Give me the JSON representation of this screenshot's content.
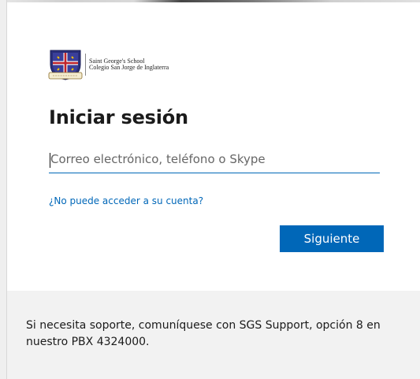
{
  "brand": {
    "crest_icon": "school-crest-icon",
    "name_line1": "Saint George's School",
    "name_line2": "Colegio San Jorge de Inglaterra"
  },
  "signin": {
    "title": "Iniciar sesión",
    "email_placeholder": "Correo electrónico, teléfono o Skype",
    "email_value": "",
    "help_link": "¿No puede acceder a su cuenta?",
    "next_label": "Siguiente"
  },
  "footer": {
    "support_text": "Si necesita soporte, comuníquese con SGS Support, opción 8 en nuestro PBX 4324000."
  },
  "colors": {
    "accent": "#0067b8",
    "footer_bg": "#f2f2f2",
    "text": "#1b1b1b"
  }
}
